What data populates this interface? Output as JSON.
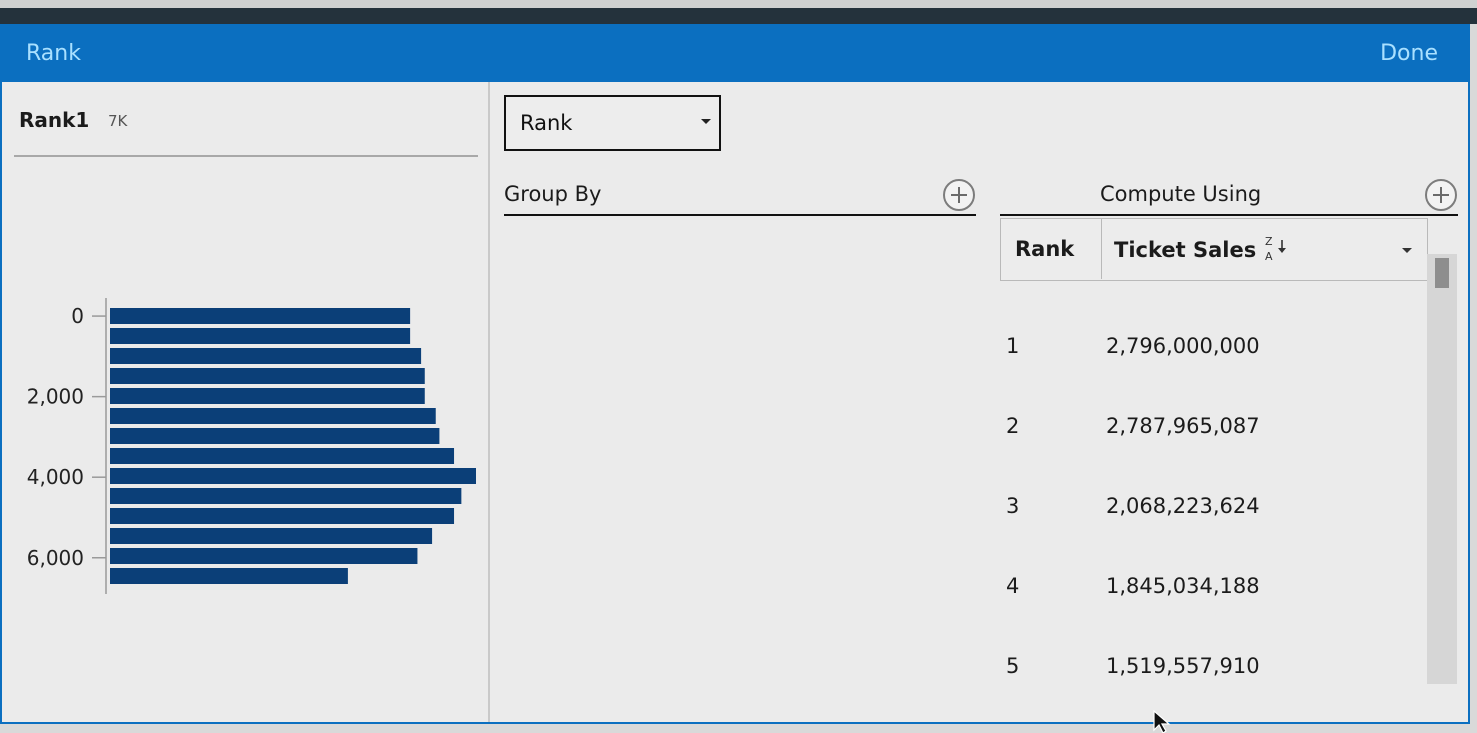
{
  "dialog": {
    "title": "Rank",
    "done_label": "Done"
  },
  "field": {
    "name": "Rank1",
    "count": "7K"
  },
  "histogram": {
    "chart_data": {
      "type": "bar",
      "orientation": "horizontal",
      "y_tick_labels": [
        "0",
        "2,000",
        "4,000",
        "6,000"
      ],
      "y_ticks": [
        0,
        2000,
        4000,
        6000
      ],
      "ylim": [
        -300,
        6900
      ],
      "bin_counts": [
        0.82,
        0.82,
        0.85,
        0.86,
        0.86,
        0.89,
        0.9,
        0.94,
        1.0,
        0.96,
        0.94,
        0.88,
        0.84,
        0.65
      ],
      "bar_color": "#0b3f78"
    }
  },
  "function_select": {
    "selected": "Rank"
  },
  "group_by": {
    "label": "Group By"
  },
  "compute_using": {
    "label": "Compute Using"
  },
  "table": {
    "columns": [
      "Rank",
      "Ticket Sales"
    ],
    "sort_icon": "sort-descending-z-a-icon",
    "rows": [
      {
        "rank": "1",
        "value": "2,796,000,000"
      },
      {
        "rank": "2",
        "value": "2,787,965,087"
      },
      {
        "rank": "3",
        "value": "2,068,223,624"
      },
      {
        "rank": "4",
        "value": "1,845,034,188"
      },
      {
        "rank": "5",
        "value": "1,519,557,910"
      }
    ]
  },
  "colors": {
    "accent": "#0b6fc0",
    "title_text": "#a9e0ff",
    "bar": "#0b3f78"
  }
}
